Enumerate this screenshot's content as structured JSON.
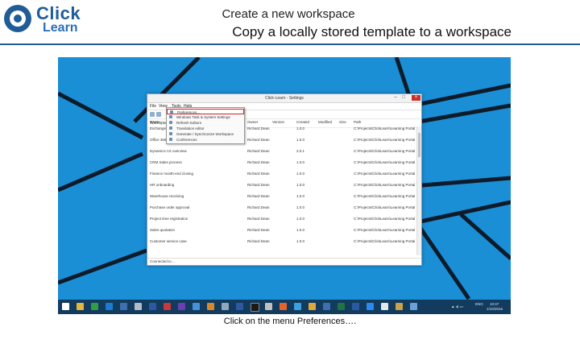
{
  "logo": {
    "line1": "Click",
    "line2": "Learn"
  },
  "header": {
    "title": "Create a new workspace",
    "subtitle": "Copy a locally stored template to a workspace"
  },
  "caption": "Click on the menu Preferences….",
  "colors": {
    "brand": "#1f5c98",
    "desktop": "#1a8fd6",
    "taskbar": "#123b5e",
    "highlight": "#d62020"
  },
  "screenshot": {
    "window": {
      "title": "Click-Learn - Settings",
      "menu": [
        "File",
        "View",
        "Tools",
        "Help"
      ],
      "panel_label": "Workspaces",
      "columns": [
        "Name",
        "Owner",
        "Version",
        "Created",
        "Modified",
        "Size",
        "Path"
      ],
      "dropdown": [
        "Preferences...",
        "Windows Task & System Settings",
        "Refresh Editors",
        "Translation editor",
        "Generate / Synchronize Workspace",
        "Conferences"
      ],
      "rows": [
        {
          "name": "Exchange Meeting Notes",
          "owner": "Richard Dean",
          "version": "1.0.0",
          "path": "C:\\Projects\\ClickLearn\\Learning Portal"
        },
        {
          "name": "Office 365 introduction",
          "owner": "Richard Dean",
          "version": "1.0.0",
          "path": "C:\\Projects\\ClickLearn\\Learning Portal"
        },
        {
          "name": "Dynamics AX overview",
          "owner": "Richard Dean",
          "version": "2.0.1",
          "path": "C:\\Projects\\ClickLearn\\Learning Portal"
        },
        {
          "name": "CRM Sales process",
          "owner": "Richard Dean",
          "version": "1.0.0",
          "path": "C:\\Projects\\ClickLearn\\Learning Portal"
        },
        {
          "name": "Finance month-end closing",
          "owner": "Richard Dean",
          "version": "1.0.0",
          "path": "C:\\Projects\\ClickLearn\\Learning Portal"
        },
        {
          "name": "HR onboarding",
          "owner": "Richard Dean",
          "version": "1.0.0",
          "path": "C:\\Projects\\ClickLearn\\Learning Portal"
        },
        {
          "name": "Warehouse receiving",
          "owner": "Richard Dean",
          "version": "1.0.0",
          "path": "C:\\Projects\\ClickLearn\\Learning Portal"
        },
        {
          "name": "Purchase order approval",
          "owner": "Richard Dean",
          "version": "1.0.0",
          "path": "C:\\Projects\\ClickLearn\\Learning Portal"
        },
        {
          "name": "Project time registration",
          "owner": "Richard Dean",
          "version": "1.0.0",
          "path": "C:\\Projects\\ClickLearn\\Learning Portal"
        },
        {
          "name": "Sales quotation",
          "owner": "Richard Dean",
          "version": "1.0.0",
          "path": "C:\\Projects\\ClickLearn\\Learning Portal"
        },
        {
          "name": "Customer service case",
          "owner": "Richard Dean",
          "version": "1.0.0",
          "path": "C:\\Projects\\ClickLearn\\Learning Portal"
        }
      ],
      "status": "Connected to ..."
    },
    "tray": {
      "lang": "ENG",
      "time": "10:47",
      "date": "1/10/2016"
    }
  }
}
